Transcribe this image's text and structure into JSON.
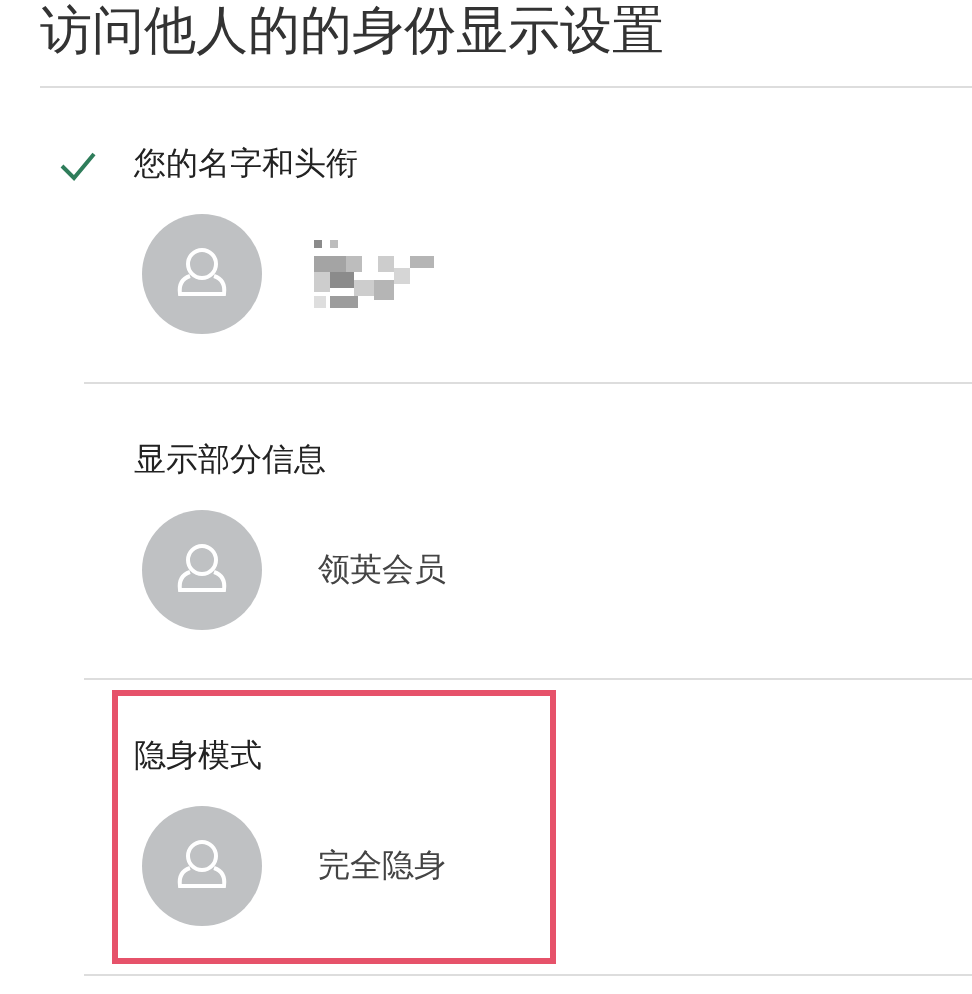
{
  "title": "访问他人的的身份显示设置",
  "options": [
    {
      "label": "您的名字和头衔",
      "selected": true,
      "highlighted": false,
      "detail": {
        "kind": "redacted"
      }
    },
    {
      "label": "显示部分信息",
      "selected": false,
      "highlighted": false,
      "detail": {
        "kind": "text",
        "text": "领英会员"
      }
    },
    {
      "label": "隐身模式",
      "selected": false,
      "highlighted": true,
      "detail": {
        "kind": "text",
        "text": "完全隐身"
      }
    }
  ]
}
